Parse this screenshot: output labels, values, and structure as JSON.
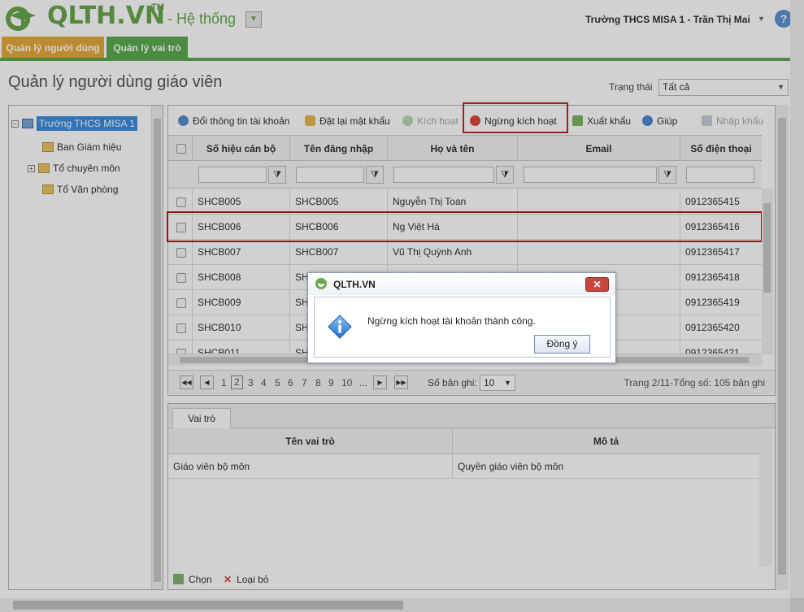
{
  "header": {
    "logo_text": "QLTH.VN",
    "logo_tm": "TM",
    "system_label": "- Hệ thống",
    "user_info": "Trường THCS MISA 1 - Trần Thị Mai",
    "help_icon": "?"
  },
  "nav_tabs": [
    {
      "label": "Quản lý người dùng",
      "active": true
    },
    {
      "label": "Quản lý vai trò",
      "active": false
    }
  ],
  "page": {
    "title": "Quản lý người dùng giáo viên",
    "status_label": "Trạng thái",
    "status_value": "Tất cả"
  },
  "tree": {
    "root": "Trường THCS MISA 1",
    "children": [
      "Ban Giám hiệu",
      "Tổ chuyên môn",
      "Tổ Văn phòng"
    ]
  },
  "toolbar": {
    "change_info": "Đổi thông tin tài khoản",
    "reset_password": "Đặt lại mật khẩu",
    "activate": "Kích hoạt",
    "deactivate": "Ngừng kích hoạt",
    "export": "Xuất khẩu",
    "help": "Giúp",
    "import": "Nhập khẩu"
  },
  "grid": {
    "columns": [
      "Số hiệu cán bộ",
      "Tên đăng nhập",
      "Họ và tên",
      "Email",
      "Số điện thoại"
    ],
    "rows": [
      {
        "code": "SHCB005",
        "username": "SHCB005",
        "name": "Nguyễn Thị Toan",
        "email": "",
        "phone": "0912365415"
      },
      {
        "code": "SHCB006",
        "username": "SHCB006",
        "name": "Ng Việt Hà",
        "email": "",
        "phone": "0912365416"
      },
      {
        "code": "SHCB007",
        "username": "SHCB007",
        "name": "Vũ Thị Quỳnh Anh",
        "email": "",
        "phone": "0912365417"
      },
      {
        "code": "SHCB008",
        "username": "SH",
        "name": "",
        "email": "",
        "phone": "0912365418"
      },
      {
        "code": "SHCB009",
        "username": "SH",
        "name": "",
        "email": "",
        "phone": "0912365419"
      },
      {
        "code": "SHCB010",
        "username": "SH",
        "name": "",
        "email": "",
        "phone": "0912365420"
      },
      {
        "code": "SHCB011",
        "username": "SH",
        "name": "",
        "email": "",
        "phone": "0912365421"
      }
    ]
  },
  "pager": {
    "pages": [
      "1",
      "2",
      "3",
      "4",
      "5",
      "6",
      "7",
      "8",
      "9",
      "10",
      "..."
    ],
    "current": "2",
    "page_size_label": "Số bản ghi:",
    "page_size": "10",
    "info": "Trang 2/11-Tổng số: 105 bản ghi"
  },
  "roles": {
    "tab": "Vai trò",
    "columns": [
      "Tên vai trò",
      "Mô tả"
    ],
    "rows": [
      {
        "name": "Giáo viên bộ môn",
        "desc": "Quyền giáo viên bộ môn"
      }
    ],
    "choose": "Chọn",
    "remove": "Loại bỏ"
  },
  "dialog": {
    "title": "QLTH.VN",
    "message": "Ngừng kích hoạt tài khoản thành công.",
    "ok": "Đồng ý",
    "close": "✕"
  },
  "colors": {
    "brand_green": "#5bab4f",
    "tab_orange": "#e6a93a",
    "highlight_red": "#c0282a"
  }
}
